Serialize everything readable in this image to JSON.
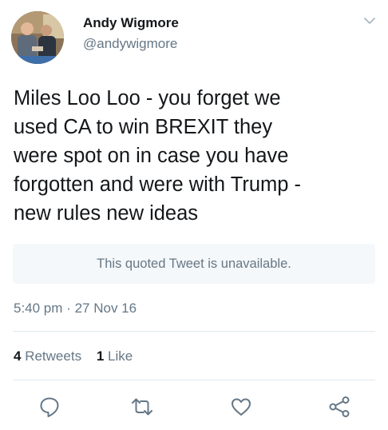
{
  "author": {
    "name": "Andy Wigmore",
    "handle": "@andywigmore"
  },
  "tweet": {
    "lines": [
      "Miles Loo Loo - you forget we",
      "used CA to win BREXIT they",
      "were spot on in case you have",
      "forgotten and were with Trump -",
      "new rules new ideas"
    ]
  },
  "quote": {
    "text": "This quoted Tweet is unavailable."
  },
  "meta": {
    "time": "5:40 pm",
    "separator": "·",
    "date": "27 Nov 16"
  },
  "stats": {
    "retweets_count": "4",
    "retweets_label": "Retweets",
    "likes_count": "1",
    "likes_label": "Like"
  },
  "actions": {
    "icons": [
      "reply-icon",
      "retweet-icon",
      "like-icon",
      "share-icon"
    ]
  },
  "colors": {
    "text": "#14171a",
    "secondary": "#657786",
    "divider": "#e1e8ed",
    "quote_bg": "#f5f8fa"
  }
}
